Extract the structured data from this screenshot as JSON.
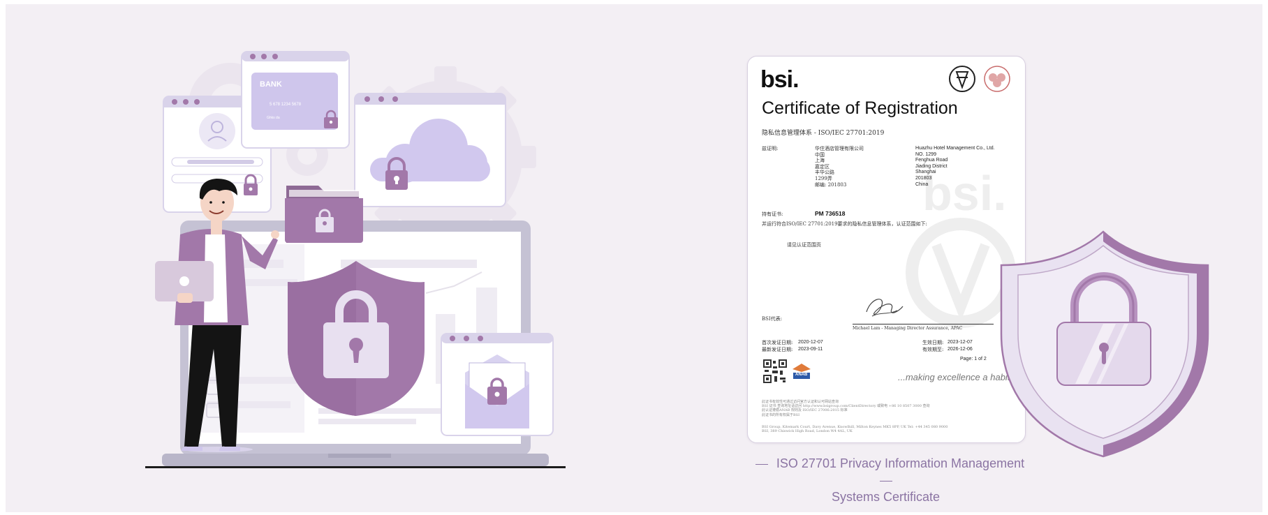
{
  "illustration": {
    "bank_card": {
      "brand": "BANK",
      "number": "5 678  1234  5678",
      "holder": "",
      "expiry": "Ghks da"
    }
  },
  "certificate": {
    "issuer_logo": "bsi.",
    "title": "Certificate of Registration",
    "scheme": "隐私信息管理体系 - ISO/IEC 27701:2019",
    "certifies_label": "兹证明:",
    "client_cn": "华住酒店管理有限公司\n中国\n上海\n嘉定区\n丰华公路\n1299弄\n邮编: 201803",
    "client_en": "Huazhu Hotel Management Co., Ltd.\nNO. 1299\nFenghua Road\nJiading District\nShanghai\n201803\nChina",
    "holder_label": "持有证书:",
    "cert_no": "PM 736518",
    "statement": "并运行符合ISO/IEC 27701:2019要求的隐私信息管理体系，认证范围如下:",
    "scope_ref": "请见认证范围页",
    "bsi_rep_label": "BSI代表:",
    "signatory": "Michael Lam - Managing Director Assurance, APAC",
    "first_issued_label": "首次发证日期:",
    "first_issued": "2020-12-07",
    "latest_issued_label": "最新发证日期:",
    "latest_issued": "2023-09-11",
    "effective_label": "生效日期:",
    "effective": "2023-12-07",
    "expiry_label": "有效期至:",
    "expiry": "2026-12-06",
    "page": "Page: 1 of 2",
    "tagline": "...making excellence a habit.\"",
    "accreditation": "ANAB",
    "fine_print_1": "此证书有效性可通过访问官方认证和认可网站查询\nBSI 证书 查询地址请访问 http://www.bsigroup.com/ClientDirectory 或致电 +86 10 8507 3000 查询\n此认证遵循ANAB 规则及 ISO/IEC 27006:2015 标准\n此证书的所有权属于BSI",
    "fine_print_2": "BSI Group, Kitemark Court, Davy Avenue, Knowlhill, Milton Keynes MK5 8PP, UK Tel: +44 345 080 9000\nBSI, 389 Chiswick High Road, London W4 4AL, UK"
  },
  "caption": {
    "line1": "ISO 27701 Privacy Information Management",
    "line2": "Systems Certificate"
  },
  "colors": {
    "background": "#f3eff4",
    "accent": "#a278a9",
    "accent_light": "#d1c8ee",
    "caption": "#8b74a3",
    "bsi_red": "#e0262a"
  }
}
